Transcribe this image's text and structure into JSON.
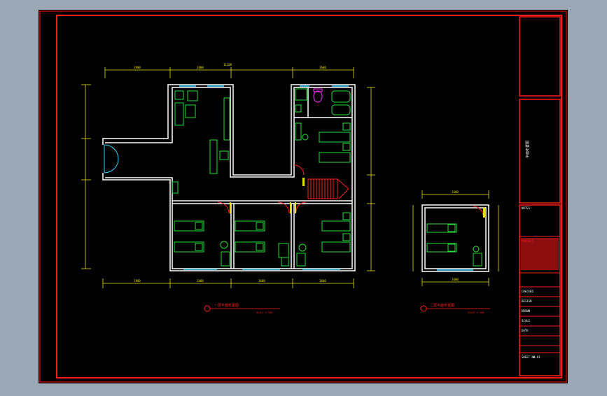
{
  "colors": {
    "background": "#9aa7b5",
    "sheet": "#000000",
    "frame": "#ff1a1a",
    "wall": "#ffffff",
    "furniture": "#22e03a",
    "window": "#34d2ff",
    "door": "#ff2020",
    "dimension": "#e8e000",
    "magenta": "#ff2bff"
  },
  "title_block": {
    "notes_heading": "NOTES:",
    "project_label": "PROJECT",
    "drawing_title": "平面布置图",
    "rows": [
      "CHECKED",
      "DESIGN",
      "DRAWN",
      "SCALE",
      "DATE",
      "SHEET NO."
    ],
    "sheet_no_value": "A-01"
  },
  "plans": {
    "main": {
      "label": "一层平面布置图",
      "scale": "SCALE 1:100",
      "top_dims": [
        "3900",
        "3600",
        "3600"
      ],
      "overall": "11100",
      "bottom_dims": [
        "3900",
        "3600",
        "3600",
        "3600"
      ]
    },
    "annex": {
      "label": "二层平面布置图",
      "scale": "SCALE 1:100",
      "top_dim": "3600",
      "bottom_dim": "3600"
    }
  }
}
